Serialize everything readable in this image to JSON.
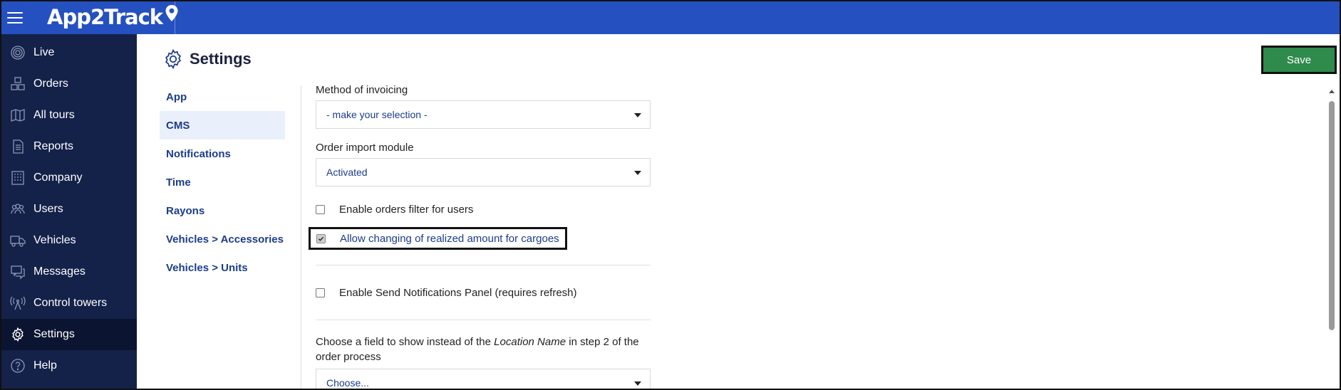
{
  "app": {
    "logo": "App2Track"
  },
  "sidebar": {
    "items": [
      {
        "label": "Live",
        "icon": "live-icon"
      },
      {
        "label": "Orders",
        "icon": "orders-icon"
      },
      {
        "label": "All tours",
        "icon": "map-icon"
      },
      {
        "label": "Reports",
        "icon": "report-icon"
      },
      {
        "label": "Company",
        "icon": "building-icon"
      },
      {
        "label": "Users",
        "icon": "users-icon"
      },
      {
        "label": "Vehicles",
        "icon": "truck-icon"
      },
      {
        "label": "Messages",
        "icon": "messages-icon"
      },
      {
        "label": "Control towers",
        "icon": "tower-icon"
      },
      {
        "label": "Settings",
        "icon": "gear-icon"
      },
      {
        "label": "Help",
        "icon": "help-icon"
      }
    ],
    "active": "Settings"
  },
  "page": {
    "title": "Settings",
    "save_label": "Save"
  },
  "subnav": {
    "items": [
      "App",
      "CMS",
      "Notifications",
      "Time",
      "Rayons",
      "Vehicles > Accessories",
      "Vehicles > Units"
    ],
    "active": "CMS"
  },
  "form": {
    "invoicing_label": "Method of invoicing",
    "invoicing_value": "- make your selection -",
    "import_label": "Order import module",
    "import_value": "Activated",
    "filter_label": "Enable orders filter for users",
    "filter_checked": false,
    "realized_label": "Allow changing of realized amount for cargoes",
    "realized_checked": true,
    "notifications_label": "Enable Send Notifications Panel (requires refresh)",
    "notifications_checked": false,
    "field_label_part1": "Choose a field to show instead of the",
    "field_label_em": "Location Name",
    "field_label_part2": "in step 2 of the order process",
    "field_value": "Choose..."
  },
  "colors": {
    "topbar": "#2550c0",
    "sidebar": "#14224a",
    "save": "#2e8b4c",
    "link": "#1b3c8a"
  }
}
